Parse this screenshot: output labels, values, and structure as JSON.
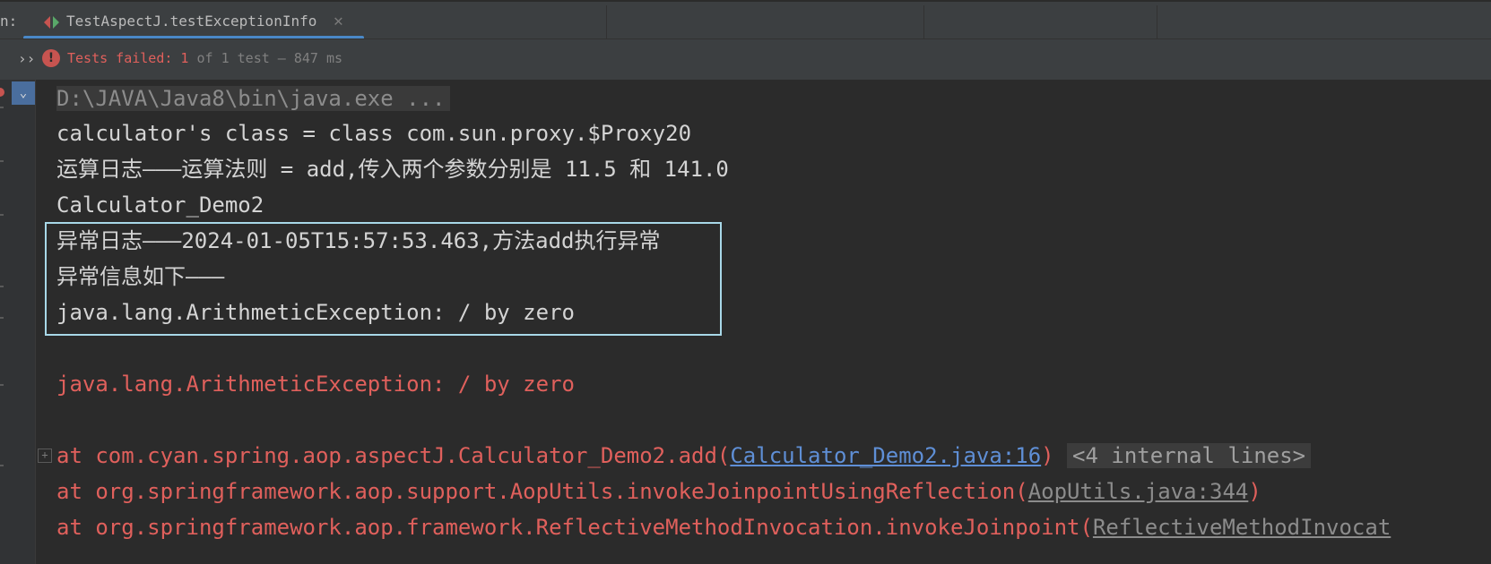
{
  "tabbar": {
    "run_label": "n:",
    "tab_title": "TestAspectJ.testExceptionInfo",
    "close_glyph": "✕"
  },
  "status": {
    "expand_glyph": "››",
    "error_glyph": "!",
    "failed_label": "Tests failed: 1",
    "rest_label": " of 1 test – 847 ms"
  },
  "gutter": {
    "scroll_glyph": "⌄"
  },
  "console": {
    "cmd": "D:\\JAVA\\Java8\\bin\\java.exe ...",
    "line1": "calculator's class = class com.sun.proxy.$Proxy20",
    "line2": "运算日志———运算法则 = add,传入两个参数分别是 11.5 和 141.0",
    "line3": "Calculator_Demo2",
    "line4": "异常日志———2024-01-05T15:57:53.463,方法add执行异常",
    "line5": "异常信息如下———",
    "line6": "java.lang.ArithmeticException: / by zero",
    "exception": "java.lang.ArithmeticException: / by zero",
    "stack": [
      {
        "prefix": "    at com.cyan.spring.aop.aspectJ.Calculator_Demo2.add(",
        "link": "Calculator_Demo2.java:16",
        "suffix": ")",
        "extra": "<4 internal lines>"
      },
      {
        "prefix": "    at org.springframework.aop.support.AopUtils.invokeJoinpointUsingReflection(",
        "link": "AopUtils.java:344",
        "suffix": ")"
      },
      {
        "prefix": "    at org.springframework.aop.framework.ReflectiveMethodInvocation.invokeJoinpoint(",
        "link": "ReflectiveMethodInvocat"
      }
    ],
    "fold_glyph": "+"
  },
  "colors": {
    "background": "#2b2b2b",
    "error": "#e0605c",
    "link": "#5f8fd6",
    "highlight_box": "#a8d8e8",
    "tab_underline": "#4a88c7"
  },
  "icons": [
    "run-tab-icon",
    "close-icon",
    "expand-icon",
    "error-icon",
    "scroll-to-end-icon",
    "fold-icon"
  ]
}
